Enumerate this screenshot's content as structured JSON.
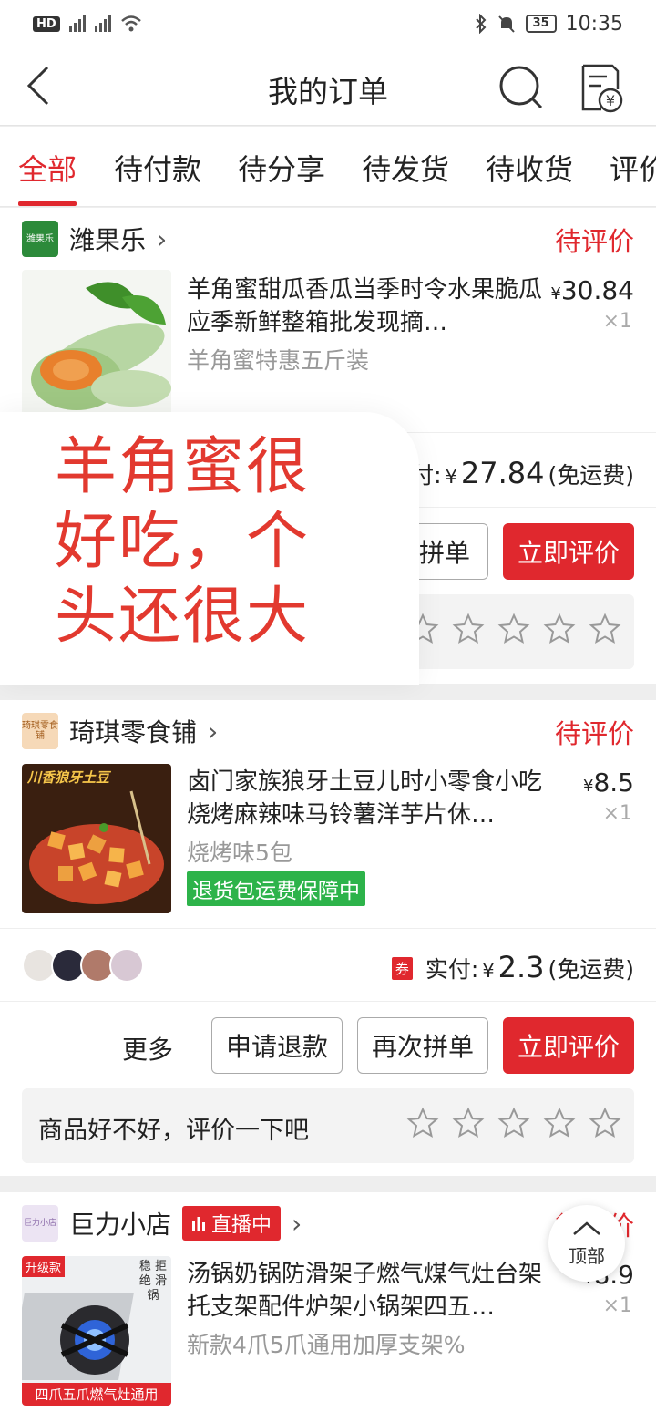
{
  "status_bar": {
    "left": "HD 4G 2G",
    "time": "10:35",
    "battery": "35"
  },
  "nav": {
    "title": "我的订单"
  },
  "tabs": [
    "全部",
    "待付款",
    "待分享",
    "待发货",
    "待收货",
    "评价"
  ],
  "orders": [
    {
      "shop": "潍果乐",
      "shop_logo_text": "潍果乐",
      "status": "待评价",
      "title": "羊角蜜甜瓜香瓜当季时令水果脆瓜应季新鲜整箱批发现摘…",
      "price": "30.84",
      "currency": "¥",
      "qty": "×1",
      "spec": "羊角蜜特惠五斤装",
      "pay_label": "付:",
      "pay_amount": "27.84",
      "pay_note": "(免运费)",
      "btn_partial": "拼单",
      "btn_review": "立即评价"
    },
    {
      "shop": "琦琪零食铺",
      "shop_logo_text": "琦琪零食铺",
      "status": "待评价",
      "title": "卤门家族狼牙土豆儿时小零食小吃烧烤麻辣味马铃薯洋芋片休…",
      "price": "8.5",
      "currency": "¥",
      "qty": "×1",
      "spec": "烧烤味5包",
      "badge": "退货包运费保障中",
      "thumb_banner": "川香狼牙土豆",
      "coupon": "券",
      "pay_label": "实付:",
      "pay_amount": "2.3",
      "pay_note": "(免运费)",
      "more": "更多",
      "btn_refund": "申请退款",
      "btn_rebuy": "再次拼单",
      "btn_review": "立即评价",
      "rate_prompt": "商品好不好，评价一下吧"
    },
    {
      "shop": "巨力小店",
      "shop_logo_text": "巨力小店",
      "live": "直播中",
      "status": "待评价",
      "title": "汤锅奶锅防滑架子燃气煤气灶台架托支架配件炉架小锅架四五…",
      "price": "8.9",
      "currency": "¥",
      "qty": "×1",
      "spec": "新款4爪5爪通用加厚支架%",
      "thumb_tag": "升级款",
      "thumb_side": "稳 拒绝 滑锅",
      "thumb_banner": "四爪五爪燃气灶通用"
    }
  ],
  "overlay": {
    "text": "羊角蜜很好吃，个头还很大"
  },
  "top_button": {
    "label": "顶部"
  },
  "colors": {
    "accent": "#e0282e",
    "green": "#2db34a"
  }
}
